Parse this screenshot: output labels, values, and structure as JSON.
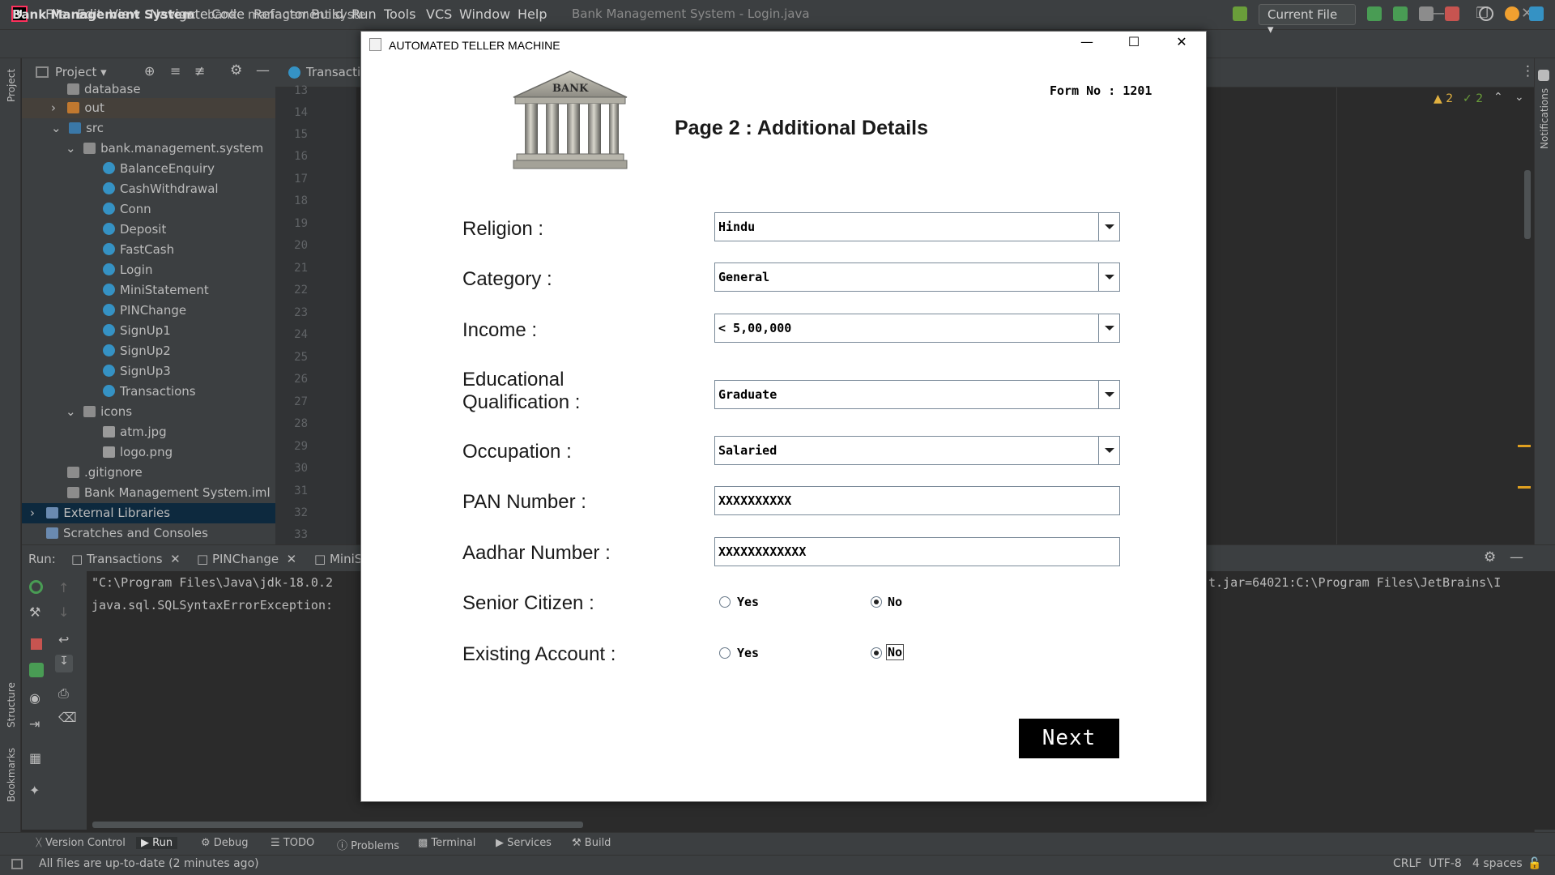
{
  "ide": {
    "menu": [
      "File",
      "Edit",
      "View",
      "Navigate",
      "Code",
      "Refactor",
      "Build",
      "Run",
      "Tools",
      "VCS",
      "Window",
      "Help"
    ],
    "window_title": "Bank Management System - Login.java",
    "breadcrumbs": [
      "Bank Management System",
      "src",
      "bank",
      "management",
      "syste"
    ],
    "run_config": "Current File",
    "editor_tab": "Transactio",
    "inspections": {
      "warnings": "2",
      "weak_warnings": "2"
    },
    "project_panel": {
      "title": "Project",
      "tree": [
        {
          "label": "database",
          "kind": "folder"
        },
        {
          "label": "out",
          "kind": "folder-orange"
        },
        {
          "label": "src",
          "kind": "folder-blue"
        },
        {
          "label": "bank.management.system",
          "kind": "package"
        },
        {
          "label": "BalanceEnquiry",
          "kind": "class"
        },
        {
          "label": "CashWithdrawal",
          "kind": "class"
        },
        {
          "label": "Conn",
          "kind": "class"
        },
        {
          "label": "Deposit",
          "kind": "class"
        },
        {
          "label": "FastCash",
          "kind": "class"
        },
        {
          "label": "Login",
          "kind": "class"
        },
        {
          "label": "MiniStatement",
          "kind": "class"
        },
        {
          "label": "PINChange",
          "kind": "class"
        },
        {
          "label": "SignUp1",
          "kind": "class"
        },
        {
          "label": "SignUp2",
          "kind": "class"
        },
        {
          "label": "SignUp3",
          "kind": "class"
        },
        {
          "label": "Transactions",
          "kind": "class"
        },
        {
          "label": "icons",
          "kind": "package"
        },
        {
          "label": "atm.jpg",
          "kind": "file"
        },
        {
          "label": "logo.png",
          "kind": "file"
        },
        {
          "label": ".gitignore",
          "kind": "file"
        },
        {
          "label": "Bank Management System.iml",
          "kind": "file"
        },
        {
          "label": "External Libraries",
          "kind": "lib"
        },
        {
          "label": "Scratches and Consoles",
          "kind": "scratch"
        }
      ]
    },
    "line_numbers": [
      "13",
      "14",
      "15",
      "16",
      "17",
      "18",
      "19",
      "20",
      "21",
      "22",
      "23",
      "24",
      "25",
      "26",
      "27",
      "28",
      "29",
      "30",
      "31",
      "32",
      "33"
    ],
    "run_panel": {
      "label": "Run:",
      "tabs": [
        "Transactions",
        "PINChange",
        "MiniS"
      ],
      "console": [
        "\"C:\\Program Files\\Java\\jdk-18.0.2",
        "java.sql.SQLSyntaxErrorException:"
      ],
      "console_right": "t.jar=64021:C:\\Program Files\\JetBrains\\I"
    },
    "left_stripe": [
      "Project",
      "Structure",
      "Bookmarks"
    ],
    "right_stripe": "Notifications",
    "tool_windows": [
      "Version Control",
      "Run",
      "Debug",
      "TODO",
      "Problems",
      "Terminal",
      "Services",
      "Build"
    ],
    "status": {
      "message": "All files are up-to-date (2 minutes ago)",
      "line_sep": "CRLF",
      "encoding": "UTF-8",
      "indent": "4 spaces"
    }
  },
  "dialog": {
    "title": "AUTOMATED TELLER MACHINE",
    "logo_text": "BANK",
    "form_no": "Form No : 1201",
    "heading": "Page 2 : Additional Details",
    "fields": {
      "religion": {
        "label": "Religion :",
        "value": "Hindu"
      },
      "category": {
        "label": "Category :",
        "value": "General"
      },
      "income": {
        "label": "Income :",
        "value": "< 5,00,000"
      },
      "education": {
        "label_line1": "Educational",
        "label_line2": "Qualification :",
        "value": "Graduate"
      },
      "occupation": {
        "label": "Occupation :",
        "value": "Salaried"
      },
      "pan": {
        "label": "PAN Number :",
        "value": "XXXXXXXXXX"
      },
      "aadhar": {
        "label": "Aadhar Number :",
        "value": "XXXXXXXXXXXX"
      }
    },
    "senior_citizen": {
      "label": "Senior Citizen :",
      "yes": "Yes",
      "no": "No",
      "selected": "No"
    },
    "existing_account": {
      "label": "Existing Account :",
      "yes": "Yes",
      "no": "No",
      "selected": "No"
    },
    "next_label": "Next"
  }
}
